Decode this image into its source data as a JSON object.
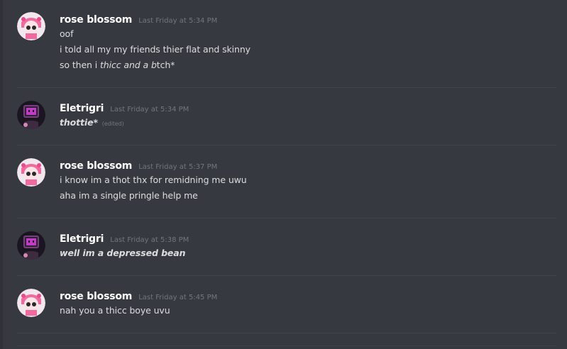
{
  "messages": [
    {
      "author": "rose blossom",
      "avatar": "pink-anime-girl-avatar",
      "timestamp": "Last Friday at 5:34 PM",
      "lines": [
        {
          "plain": "oof"
        },
        {
          "plain": "i told all my my friends thier flat and skinny"
        },
        {
          "before": "so then i ",
          "italic": "thicc and a b",
          "after": "tch*"
        }
      ]
    },
    {
      "author": "Eletrigri",
      "avatar": "tv-head-character-avatar",
      "timestamp": "Last Friday at 5:34 PM",
      "lines": [
        {
          "bold_italic": "thottie*",
          "edited": "(edited)"
        }
      ]
    },
    {
      "author": "rose blossom",
      "avatar": "pink-anime-girl-avatar",
      "timestamp": "Last Friday at 5:37 PM",
      "lines": [
        {
          "plain": "i know im a thot thx for remidning me uwu"
        },
        {
          "plain": "aha im a single pringle help me"
        }
      ]
    },
    {
      "author": "Eletrigri",
      "avatar": "tv-head-character-avatar",
      "timestamp": "Last Friday at 5:38 PM",
      "lines": [
        {
          "bold_italic": "well im a depressed bean"
        }
      ]
    },
    {
      "author": "rose blossom",
      "avatar": "pink-anime-girl-avatar",
      "timestamp": "Last Friday at 5:45 PM",
      "lines": [
        {
          "plain": "nah you a thicc boye uvu"
        }
      ]
    }
  ],
  "colors": {
    "background": "#36393f",
    "username": "#ffffff",
    "timestamp": "#72767d",
    "text": "#dcddde",
    "divider": "#42454a"
  }
}
